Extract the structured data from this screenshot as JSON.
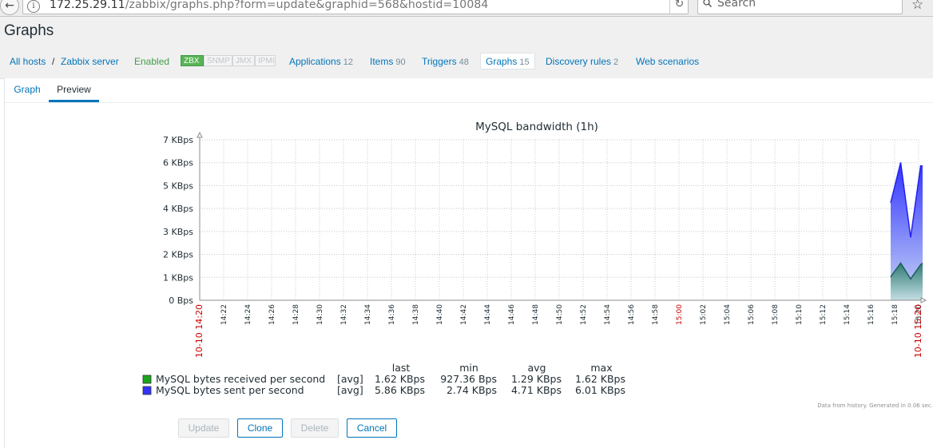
{
  "browser": {
    "back_icon": "back-arrow-icon",
    "url_host": "172.25.29.11",
    "url_path": "/zabbix/graphs.php?form=update&graphid=568&hostid=10084",
    "search_placeholder": "Search"
  },
  "page": {
    "title": "Graphs"
  },
  "host_nav": {
    "all_hosts": "All hosts",
    "separator": "/",
    "host": "Zabbix server",
    "status": "Enabled",
    "availability": [
      "ZBX",
      "SNMP",
      "JMX",
      "IPMI"
    ],
    "links": [
      {
        "label": "Applications",
        "count": "12"
      },
      {
        "label": "Items",
        "count": "90"
      },
      {
        "label": "Triggers",
        "count": "48"
      },
      {
        "label": "Graphs",
        "count": "15"
      },
      {
        "label": "Discovery rules",
        "count": "2"
      },
      {
        "label": "Web scenarios",
        "count": ""
      }
    ]
  },
  "tabs": [
    {
      "label": "Graph"
    },
    {
      "label": "Preview"
    }
  ],
  "active_tab": "Preview",
  "chart_data": {
    "type": "area",
    "title": "MySQL bandwidth (1h)",
    "y_ticks": [
      "0 Bps",
      "1 KBps",
      "2 KBps",
      "3 KBps",
      "4 KBps",
      "5 KBps",
      "6 KBps",
      "7 KBps"
    ],
    "ylim": [
      0,
      7
    ],
    "x_ticks": [
      "10-10 14:20",
      "14:22",
      "14:24",
      "14:26",
      "14:28",
      "14:30",
      "14:32",
      "14:34",
      "14:36",
      "14:38",
      "14:40",
      "14:42",
      "14:44",
      "14:46",
      "14:48",
      "14:50",
      "14:52",
      "14:54",
      "14:56",
      "14:58",
      "15:00",
      "15:02",
      "15:04",
      "15:06",
      "15:08",
      "15:10",
      "15:12",
      "15:14",
      "15:16",
      "15:18",
      "15:20",
      "10-10 15:20"
    ],
    "x_tick_red": [
      "10-10 14:20",
      "15:00",
      "10-10 15:20"
    ],
    "series": [
      {
        "name": "MySQL bytes received per second",
        "color": "#1aa61a",
        "stat": "[avg]",
        "last": "1.62 KBps",
        "min": "927.36 Bps",
        "avg": "1.29 KBps",
        "max": "1.62 KBps",
        "points": [
          [
            "15:17:40",
            1.02
          ],
          [
            "15:18:30",
            1.62
          ],
          [
            "15:19:20",
            0.93
          ],
          [
            "15:20:10",
            1.55
          ],
          [
            "15:20:20",
            1.62
          ]
        ]
      },
      {
        "name": "MySQL bytes sent per second",
        "color": "#3333ff",
        "stat": "[avg]",
        "last": "5.86 KBps",
        "min": "2.74 KBps",
        "avg": "4.71 KBps",
        "max": "6.01 KBps",
        "points": [
          [
            "15:17:40",
            4.25
          ],
          [
            "15:18:30",
            6.01
          ],
          [
            "15:19:20",
            2.74
          ],
          [
            "15:20:10",
            5.86
          ],
          [
            "15:20:20",
            5.86
          ]
        ]
      }
    ],
    "legend_headers": {
      "last": "last",
      "min": "min",
      "avg": "avg",
      "max": "max"
    },
    "footer": "Data from history. Generated in 0.06 sec."
  },
  "buttons": {
    "update": "Update",
    "clone": "Clone",
    "delete": "Delete",
    "cancel": "Cancel"
  }
}
